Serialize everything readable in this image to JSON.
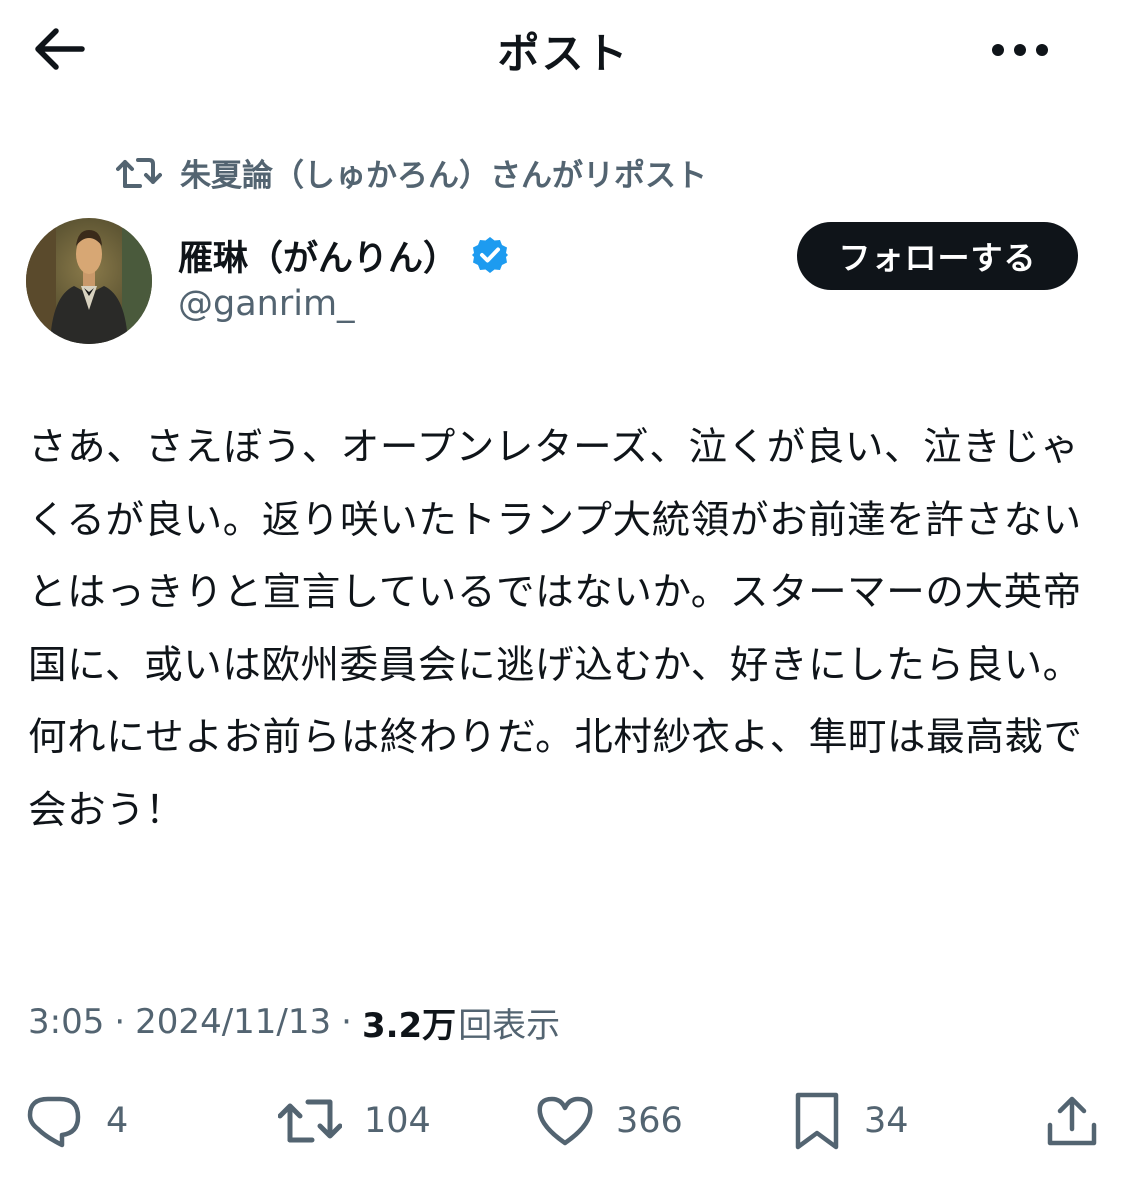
{
  "header": {
    "title": "ポスト",
    "back_icon": "arrow-left-icon",
    "more_icon": "more-horizontal-icon"
  },
  "repost": {
    "icon": "repost-icon",
    "text": "朱夏論（しゅかろん）さんがリポスト"
  },
  "author": {
    "name": "雁琳（がんりん）",
    "verified_icon": "verified-badge-icon",
    "handle": "@ganrim_",
    "follow_label": "フォローする"
  },
  "post": {
    "text": "さあ、さえぼう、オープンレターズ、泣くが良い、泣きじゃくるが良い。返り咲いたトランプ大統領がお前達を許さないとはっきりと宣言しているではないか。スターマーの大英帝国に、或いは欧州委員会に逃げ込むか、好きにしたら良い。何れにせよお前らは終わりだ。北村紗衣よ、隼町は最高裁で会おう！"
  },
  "meta": {
    "time": "3:05",
    "separator": "·",
    "date": "2024/11/13",
    "views_count": "3.2万",
    "views_label": "回表示"
  },
  "actions": {
    "reply": {
      "icon": "reply-icon",
      "count": "4"
    },
    "repost": {
      "icon": "repost-icon",
      "count": "104"
    },
    "like": {
      "icon": "heart-icon",
      "count": "366"
    },
    "bookmark": {
      "icon": "bookmark-icon",
      "count": "34"
    },
    "share": {
      "icon": "share-icon"
    }
  },
  "colors": {
    "text_primary": "#0f1419",
    "text_secondary": "#536471",
    "verified_blue": "#1d9bf0",
    "follow_button_bg": "#0f1419"
  }
}
